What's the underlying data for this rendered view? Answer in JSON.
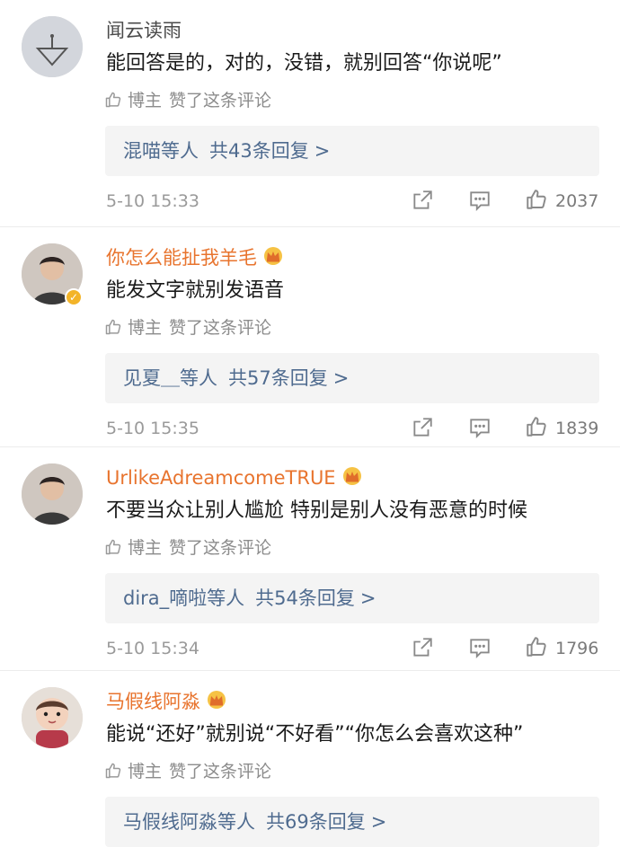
{
  "comments": [
    {
      "username": "闻云读雨",
      "name_style": "plain",
      "vip": false,
      "content": "能回答是的，对的，没错，就别回答“你说呢”",
      "liked_author": "博主",
      "liked_text": "赞了这条评论",
      "reply_users": "混喵等人",
      "reply_count": "共43条回复",
      "reply_arrow": ">",
      "time": "5-10 15:33",
      "likes": "2037",
      "avatar_icon": "triangle-avatar"
    },
    {
      "username": "你怎么能扯我羊毛",
      "name_style": "vip",
      "vip": true,
      "content": "能发文字就别发语音",
      "liked_author": "博主",
      "liked_text": "赞了这条评论",
      "reply_users": "见夏＿等人",
      "reply_count": "共57条回复",
      "reply_arrow": ">",
      "time": "5-10 15:35",
      "likes": "1839",
      "avatar_icon": "person-avatar"
    },
    {
      "username": "UrlikeAdreamcomeTRUE",
      "name_style": "vip",
      "vip": false,
      "content": "不要当众让别人尴尬 特别是别人没有恶意的时候",
      "liked_author": "博主",
      "liked_text": "赞了这条评论",
      "reply_users": "dira_嘀啦等人",
      "reply_count": "共54条回复",
      "reply_arrow": ">",
      "time": "5-10 15:34",
      "likes": "1796",
      "avatar_icon": "person-avatar"
    },
    {
      "username": "马假线阿淼",
      "name_style": "vip",
      "vip": false,
      "content": "能说“还好”就别说“不好看”“你怎么会喜欢这种”",
      "liked_author": "博主",
      "liked_text": "赞了这条评论",
      "reply_users": "马假线阿淼等人",
      "reply_count": "共69条回复",
      "reply_arrow": ">",
      "time": "",
      "likes": "",
      "avatar_icon": "baby-avatar"
    }
  ],
  "colors": {
    "vip_name": "#e8742e",
    "reply_link": "#4f6b8f",
    "meta_gray": "#9a9a9a"
  },
  "icons": {
    "share": "share-icon",
    "comment": "comment-icon",
    "like": "thumb-up-icon",
    "crown": "crown-icon",
    "verified": "verified-badge-icon"
  }
}
